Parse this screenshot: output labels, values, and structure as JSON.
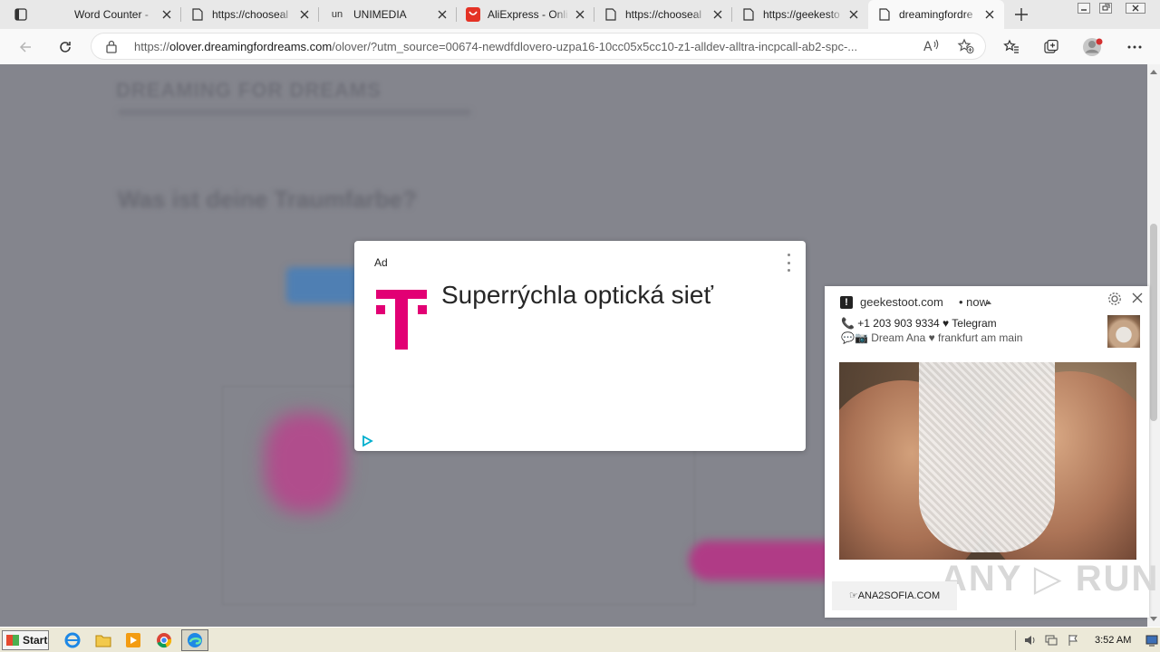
{
  "browser": {
    "tabs": [
      {
        "title": "Word Counter - ",
        "icon": "blank-icon"
      },
      {
        "title": "https://chooseal",
        "icon": "page-icon"
      },
      {
        "title": "UNIMEDIA",
        "icon": "unimedia-icon",
        "icon_text": "un"
      },
      {
        "title": "AliExpress - Onli",
        "icon": "aliexpress-icon"
      },
      {
        "title": "https://chooseal",
        "icon": "page-icon"
      },
      {
        "title": "https://geekesto",
        "icon": "page-icon"
      },
      {
        "title": "dreamingfordre",
        "icon": "page-icon",
        "active": true
      }
    ],
    "url_host": "olover.dreamingfordreams.com",
    "url_prefix": "https://",
    "url_rest": "/olover/?utm_source=00674-newdfdlovero-uzpa16-10cc05x5cc10-z1-alldev-alltra-incpcall-ab2-spc-...",
    "avatar_dot_color": "#d32f2f"
  },
  "page": {
    "ghost_title": "DREAMING FOR DREAMS",
    "ghost_heading": "Was ist deine Traumfarbe?"
  },
  "ad": {
    "label": "Ad",
    "headline": "Superrýchla optická sieť",
    "brand_color": "#e20074",
    "adchoices_color": "#00aecd"
  },
  "notification": {
    "badge": "!",
    "site": "geekestoot.com",
    "time": "• now",
    "line1": "📞 +1 203 903 9334 ♥ Telegram",
    "line2": "💬📷 Dream Ana ♥ frankfurt am main",
    "cta": "☞ANA2SOFIA.COM",
    "watermark": "ANY ▷ RUN"
  },
  "taskbar": {
    "start_label": "Start",
    "clock": "3:52 AM"
  }
}
